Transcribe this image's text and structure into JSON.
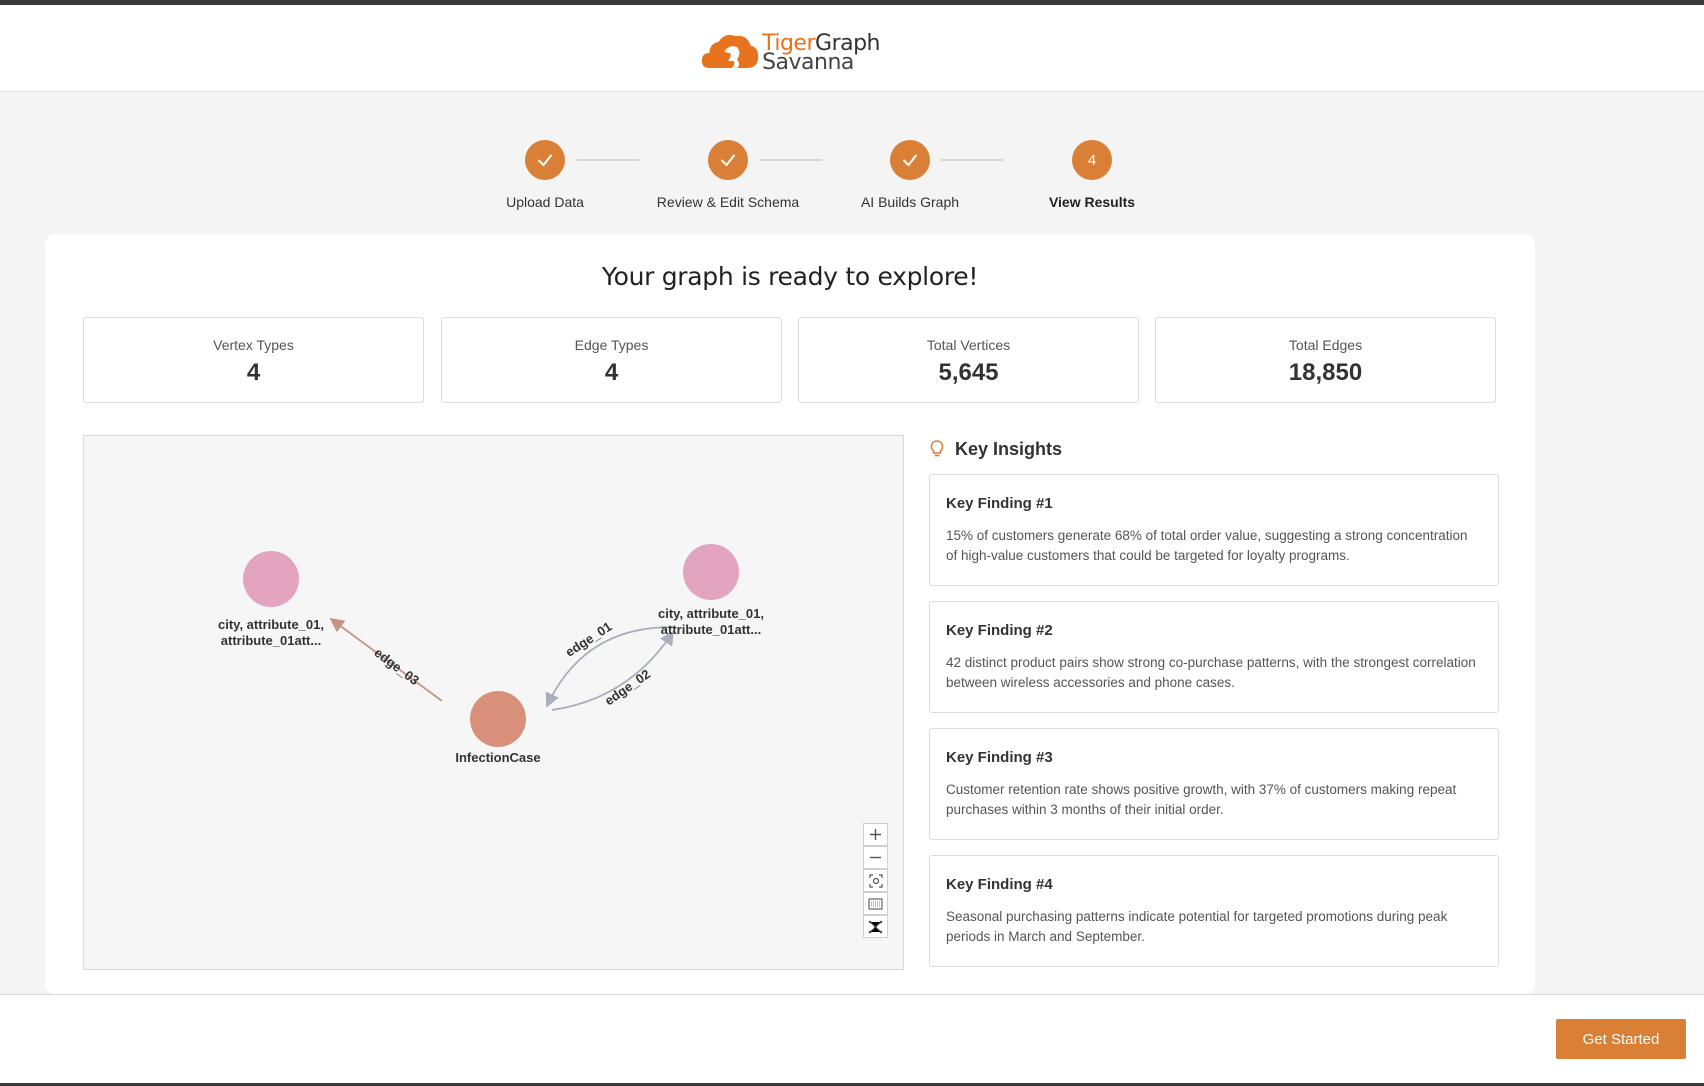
{
  "brand": {
    "name_part1": "Tiger",
    "name_part2": "Graph",
    "name_line2": "Savanna",
    "accent": "#d97f36"
  },
  "stepper": {
    "steps": [
      {
        "label": "Upload Data",
        "state": "done",
        "icon": "check-icon"
      },
      {
        "label": "Review & Edit  Schema",
        "state": "done",
        "icon": "check-icon"
      },
      {
        "label": "AI Builds Graph",
        "state": "done",
        "icon": "check-icon"
      },
      {
        "label": "View Results",
        "state": "active",
        "number": "4"
      }
    ]
  },
  "main": {
    "headline": "Your graph is ready to explore!",
    "stats": [
      {
        "label": "Vertex Types",
        "value": "4"
      },
      {
        "label": "Edge Types",
        "value": "4"
      },
      {
        "label": "Total Vertices",
        "value": "5,645"
      },
      {
        "label": "Total Edges",
        "value": "18,850"
      }
    ]
  },
  "graph": {
    "nodes": [
      {
        "id": "left",
        "label_line1": "city, attribute_01,",
        "label_line2": "attribute_01att...",
        "color": "#e3a4c0"
      },
      {
        "id": "right",
        "label_line1": "city, attribute_01,",
        "label_line2": "attribute_01att...",
        "color": "#e3a4c0"
      },
      {
        "id": "center",
        "label_line1": "InfectionCase",
        "color": "#d9907a"
      }
    ],
    "edges": [
      {
        "label": "edge_01",
        "from": "center",
        "to": "right"
      },
      {
        "label": "edge_02",
        "from": "center",
        "to": "right"
      },
      {
        "label": "edge_03",
        "from": "center",
        "to": "left"
      }
    ],
    "controls": [
      "zoom-in-icon",
      "zoom-out-icon",
      "fit-view-icon",
      "minimap-icon",
      "layout-icon"
    ]
  },
  "insights": {
    "title": "Key Insights",
    "icon": "lightbulb-icon",
    "findings": [
      {
        "title": "Key Finding #1",
        "text": "15% of customers generate 68% of total order value, suggesting a strong concentration of high-value customers that could be targeted for loyalty programs."
      },
      {
        "title": "Key Finding #2",
        "text": "42 distinct product pairs show strong co-purchase patterns, with the strongest correlation between wireless accessories and phone cases."
      },
      {
        "title": "Key Finding #3",
        "text": "Customer retention rate shows positive growth, with 37% of customers making repeat purchases within 3 months of their initial order."
      },
      {
        "title": "Key Finding #4",
        "text": "Seasonal purchasing patterns indicate potential for targeted promotions during peak periods in March and September."
      }
    ]
  },
  "footer": {
    "cta_label": "Get Started"
  }
}
